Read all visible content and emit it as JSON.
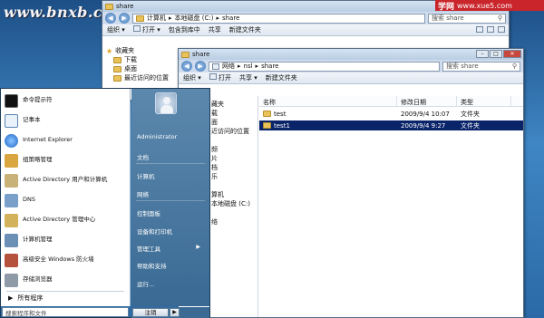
{
  "watermarks": {
    "left": "www.bnxb.com",
    "right_cn": "学网",
    "right_url": "www.xue5.com"
  },
  "window_back": {
    "title": "share",
    "address": [
      "计算机",
      "本地磁盘 (C:)",
      "share"
    ],
    "search_placeholder": "搜索 share",
    "toolbar": [
      "组织",
      "打开",
      "包含到库中",
      "共享",
      "新建文件夹"
    ],
    "nav": {
      "favorites": "收藏夹",
      "items": [
        "下载",
        "桌面",
        "最近访问的位置"
      ]
    }
  },
  "window_front": {
    "title": "share",
    "address": [
      "网络",
      "nsl",
      "share"
    ],
    "search_placeholder": "搜索 share",
    "toolbar": [
      "组织",
      "打开",
      "共享",
      "新建文件夹"
    ],
    "nav_fragments": [
      "藏夹",
      "载",
      "面",
      "近访问的位置",
      "",
      "频",
      "片",
      "档",
      "乐",
      "",
      "算机",
      "本地磁盘 (C:)",
      "",
      "络"
    ],
    "columns": [
      "名称",
      "修改日期",
      "类型"
    ],
    "files": [
      {
        "name": "test",
        "date": "2009/9/4 10:07",
        "type": "文件夹",
        "selected": false
      },
      {
        "name": "test1",
        "date": "2009/9/4 9:27",
        "type": "文件夹",
        "selected": true
      }
    ]
  },
  "start_menu": {
    "programs": [
      {
        "label": "命令提示符",
        "icon": "cmd-icon",
        "arrow": false
      },
      {
        "label": "记事本",
        "icon": "notepad-icon",
        "arrow": false
      },
      {
        "label": "Internet Explorer",
        "icon": "ie-icon",
        "arrow": false
      },
      {
        "label": "组策略管理",
        "icon": "gpo-icon",
        "arrow": false
      },
      {
        "label": "Active Directory 用户和计算机",
        "icon": "ad-users-icon",
        "arrow": false
      },
      {
        "label": "DNS",
        "icon": "dns-icon",
        "arrow": false
      },
      {
        "label": "Active Directory 管理中心",
        "icon": "ad-admin-icon",
        "arrow": false
      },
      {
        "label": "计算机管理",
        "icon": "computer-mgmt-icon",
        "arrow": false
      },
      {
        "label": "高级安全 Windows 防火墙",
        "icon": "firewall-icon",
        "arrow": false
      },
      {
        "label": "存储浏览器",
        "icon": "storage-icon",
        "arrow": false
      }
    ],
    "all_programs": "所有程序",
    "search_placeholder": "搜索程序和文件",
    "right_items": [
      "Administrator",
      "文档",
      "计算机",
      "网络",
      "控制面板",
      "设备和打印机",
      "管理工具",
      "帮助和支持",
      "运行..."
    ],
    "shutdown": "注销"
  },
  "colors": {
    "selection": "#0a246a",
    "start_right": "#3a6a94",
    "watermark_red": "#c9252b"
  }
}
